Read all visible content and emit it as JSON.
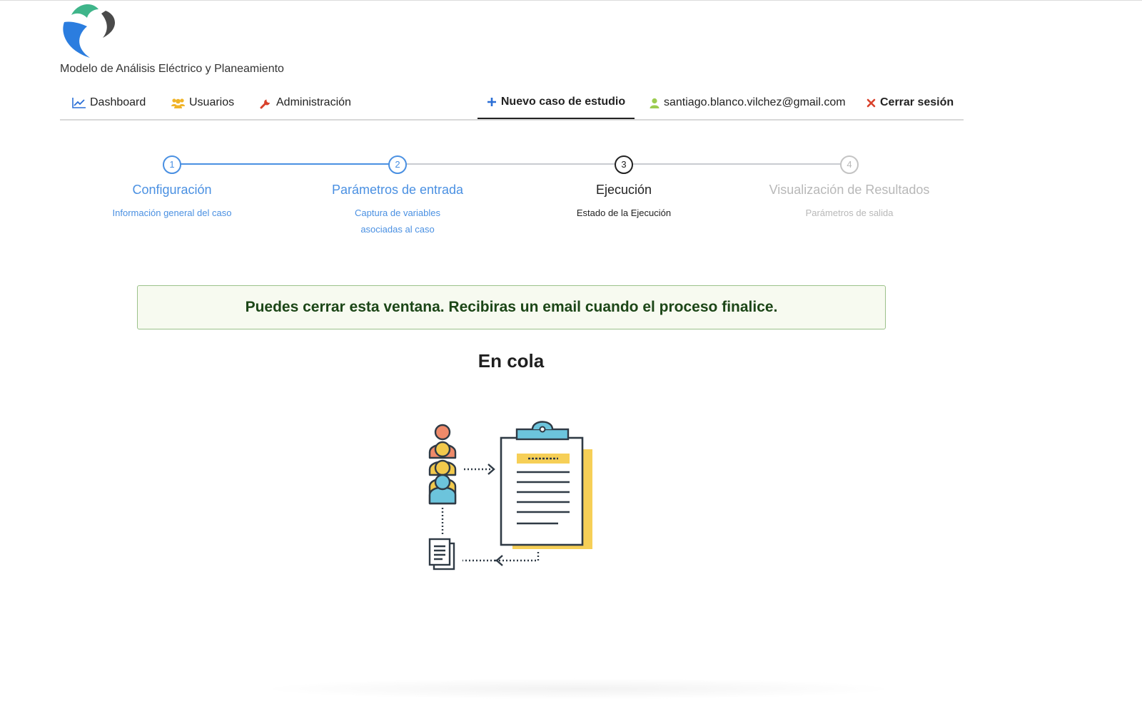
{
  "app": {
    "title": "Modelo de Análisis Eléctrico y Planeamiento",
    "logo_icon": "logo-swirl-icon"
  },
  "nav": {
    "dashboard": {
      "label": "Dashboard",
      "icon": "line-chart-icon"
    },
    "users": {
      "label": "Usuarios",
      "icon": "users-icon"
    },
    "admin": {
      "label": "Administración",
      "icon": "wrench-icon"
    },
    "new_case": {
      "label": "Nuevo caso de estudio",
      "icon": "plus-icon"
    },
    "user": {
      "label": "santiago.blanco.vilchez@gmail.com",
      "icon": "user-icon"
    },
    "logout": {
      "label": "Cerrar sesión",
      "icon": "close-icon"
    }
  },
  "steps": [
    {
      "number": "1",
      "title": "Configuración",
      "subtitle": "Información general del caso",
      "state": "done"
    },
    {
      "number": "2",
      "title": "Parámetros de entrada",
      "subtitle": "Captura de variables asociadas al caso",
      "state": "done"
    },
    {
      "number": "3",
      "title": "Ejecución",
      "subtitle": "Estado de la Ejecución",
      "state": "current"
    },
    {
      "number": "4",
      "title": "Visualización de Resultados",
      "subtitle": "Parámetros de salida",
      "state": "pending"
    }
  ],
  "alert": {
    "message": "Puedes cerrar esta ventana. Recibiras un email cuando el proceso finalice."
  },
  "status": {
    "heading": "En cola",
    "illustration_icon": "queue-clipboard-illustration"
  },
  "colors": {
    "accent": "#4a90e2",
    "pending": "#b8b8b8",
    "alert_border": "#9bc18a",
    "alert_text": "#1c4617",
    "icon_users": "#f0b429",
    "icon_admin": "#d9412b",
    "icon_user": "#9ccc50",
    "icon_logout": "#d9412b"
  }
}
